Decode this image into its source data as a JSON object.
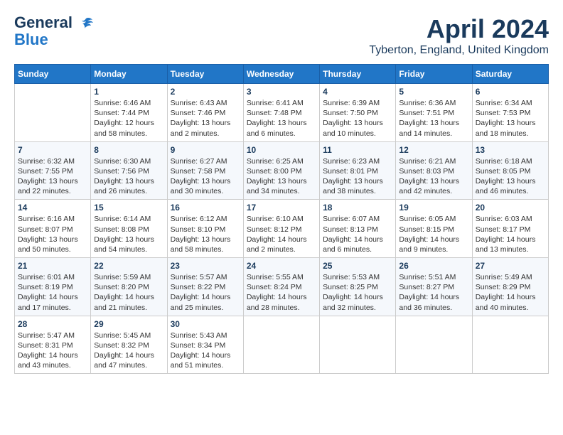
{
  "logo": {
    "line1": "General",
    "line2": "Blue"
  },
  "title": "April 2024",
  "subtitle": "Tyberton, England, United Kingdom",
  "days_of_week": [
    "Sunday",
    "Monday",
    "Tuesday",
    "Wednesday",
    "Thursday",
    "Friday",
    "Saturday"
  ],
  "weeks": [
    [
      {
        "day": "",
        "info": ""
      },
      {
        "day": "1",
        "info": "Sunrise: 6:46 AM\nSunset: 7:44 PM\nDaylight: 12 hours\nand 58 minutes."
      },
      {
        "day": "2",
        "info": "Sunrise: 6:43 AM\nSunset: 7:46 PM\nDaylight: 13 hours\nand 2 minutes."
      },
      {
        "day": "3",
        "info": "Sunrise: 6:41 AM\nSunset: 7:48 PM\nDaylight: 13 hours\nand 6 minutes."
      },
      {
        "day": "4",
        "info": "Sunrise: 6:39 AM\nSunset: 7:50 PM\nDaylight: 13 hours\nand 10 minutes."
      },
      {
        "day": "5",
        "info": "Sunrise: 6:36 AM\nSunset: 7:51 PM\nDaylight: 13 hours\nand 14 minutes."
      },
      {
        "day": "6",
        "info": "Sunrise: 6:34 AM\nSunset: 7:53 PM\nDaylight: 13 hours\nand 18 minutes."
      }
    ],
    [
      {
        "day": "7",
        "info": "Sunrise: 6:32 AM\nSunset: 7:55 PM\nDaylight: 13 hours\nand 22 minutes."
      },
      {
        "day": "8",
        "info": "Sunrise: 6:30 AM\nSunset: 7:56 PM\nDaylight: 13 hours\nand 26 minutes."
      },
      {
        "day": "9",
        "info": "Sunrise: 6:27 AM\nSunset: 7:58 PM\nDaylight: 13 hours\nand 30 minutes."
      },
      {
        "day": "10",
        "info": "Sunrise: 6:25 AM\nSunset: 8:00 PM\nDaylight: 13 hours\nand 34 minutes."
      },
      {
        "day": "11",
        "info": "Sunrise: 6:23 AM\nSunset: 8:01 PM\nDaylight: 13 hours\nand 38 minutes."
      },
      {
        "day": "12",
        "info": "Sunrise: 6:21 AM\nSunset: 8:03 PM\nDaylight: 13 hours\nand 42 minutes."
      },
      {
        "day": "13",
        "info": "Sunrise: 6:18 AM\nSunset: 8:05 PM\nDaylight: 13 hours\nand 46 minutes."
      }
    ],
    [
      {
        "day": "14",
        "info": "Sunrise: 6:16 AM\nSunset: 8:07 PM\nDaylight: 13 hours\nand 50 minutes."
      },
      {
        "day": "15",
        "info": "Sunrise: 6:14 AM\nSunset: 8:08 PM\nDaylight: 13 hours\nand 54 minutes."
      },
      {
        "day": "16",
        "info": "Sunrise: 6:12 AM\nSunset: 8:10 PM\nDaylight: 13 hours\nand 58 minutes."
      },
      {
        "day": "17",
        "info": "Sunrise: 6:10 AM\nSunset: 8:12 PM\nDaylight: 14 hours\nand 2 minutes."
      },
      {
        "day": "18",
        "info": "Sunrise: 6:07 AM\nSunset: 8:13 PM\nDaylight: 14 hours\nand 6 minutes."
      },
      {
        "day": "19",
        "info": "Sunrise: 6:05 AM\nSunset: 8:15 PM\nDaylight: 14 hours\nand 9 minutes."
      },
      {
        "day": "20",
        "info": "Sunrise: 6:03 AM\nSunset: 8:17 PM\nDaylight: 14 hours\nand 13 minutes."
      }
    ],
    [
      {
        "day": "21",
        "info": "Sunrise: 6:01 AM\nSunset: 8:19 PM\nDaylight: 14 hours\nand 17 minutes."
      },
      {
        "day": "22",
        "info": "Sunrise: 5:59 AM\nSunset: 8:20 PM\nDaylight: 14 hours\nand 21 minutes."
      },
      {
        "day": "23",
        "info": "Sunrise: 5:57 AM\nSunset: 8:22 PM\nDaylight: 14 hours\nand 25 minutes."
      },
      {
        "day": "24",
        "info": "Sunrise: 5:55 AM\nSunset: 8:24 PM\nDaylight: 14 hours\nand 28 minutes."
      },
      {
        "day": "25",
        "info": "Sunrise: 5:53 AM\nSunset: 8:25 PM\nDaylight: 14 hours\nand 32 minutes."
      },
      {
        "day": "26",
        "info": "Sunrise: 5:51 AM\nSunset: 8:27 PM\nDaylight: 14 hours\nand 36 minutes."
      },
      {
        "day": "27",
        "info": "Sunrise: 5:49 AM\nSunset: 8:29 PM\nDaylight: 14 hours\nand 40 minutes."
      }
    ],
    [
      {
        "day": "28",
        "info": "Sunrise: 5:47 AM\nSunset: 8:31 PM\nDaylight: 14 hours\nand 43 minutes."
      },
      {
        "day": "29",
        "info": "Sunrise: 5:45 AM\nSunset: 8:32 PM\nDaylight: 14 hours\nand 47 minutes."
      },
      {
        "day": "30",
        "info": "Sunrise: 5:43 AM\nSunset: 8:34 PM\nDaylight: 14 hours\nand 51 minutes."
      },
      {
        "day": "",
        "info": ""
      },
      {
        "day": "",
        "info": ""
      },
      {
        "day": "",
        "info": ""
      },
      {
        "day": "",
        "info": ""
      }
    ]
  ]
}
